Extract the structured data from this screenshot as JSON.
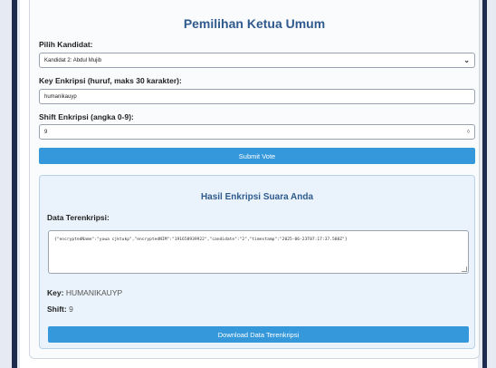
{
  "title": "Pemilihan Ketua Umum",
  "candidate": {
    "label": "Pilih Kandidat:",
    "selected": "Kandidat 2: Abdul Mujib"
  },
  "key": {
    "label": "Key Enkripsi (huruf, maks 30 karakter):",
    "value": "humanikauyp"
  },
  "shift": {
    "label": "Shift Enkripsi (angka 0-9):",
    "value": "9",
    "spinner": "◊"
  },
  "submit_label": "Submit Vote",
  "result": {
    "title": "Hasil Enkripsi Suara Anda",
    "data_label": "Data Terenkripsi:",
    "encrypted_text": "{\"encryptedName\":\"yuwa cjktukp\",\"encryptedNIM\":\"191658939922\",\"candidate\":\"2\",\"timestamp\":\"2025-06-23T07:17:37.588Z\"}",
    "key_label": "Key:",
    "key_value": "HUMANIKAUYP",
    "shift_label": "Shift:",
    "shift_value": "9",
    "download_label": "Download Data Terenkripsi"
  },
  "icons": {
    "dropdown": "chevron-down-icon",
    "spinner": "spinner-icon",
    "resize": "resize-grip-icon"
  },
  "colors": {
    "accent": "#3498db",
    "title": "#2f5a8e",
    "result_bg": "#eaf3fb"
  }
}
